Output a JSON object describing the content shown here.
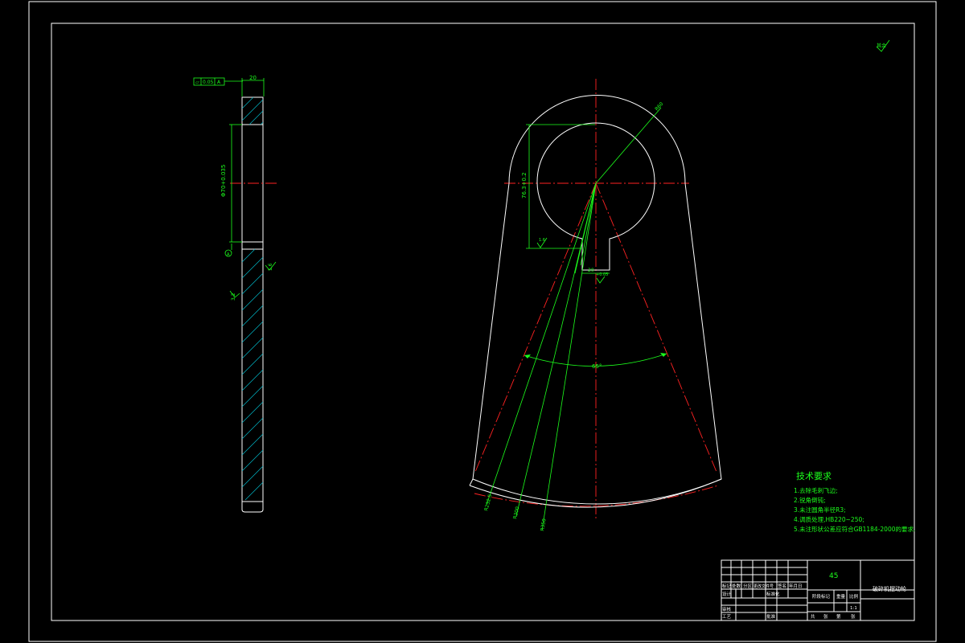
{
  "drawing": {
    "roughness_mark": "其余",
    "tolerance_frame": [
      "▱",
      "0.05",
      "A"
    ],
    "side_view": {
      "width_dim": "20",
      "bore_dim": "Φ70+0.035",
      "datum": "A",
      "roughness_right": "1.6",
      "roughness_left": "3.2"
    },
    "front_view": {
      "radius_top": "R60",
      "height_dim": "76.3+0.2",
      "roughness_bore": "1.6",
      "keyway_width": "20",
      "keyway_tol": "+0.05",
      "angle_dim": "65°",
      "radius_outer": "R232.5",
      "radius_mid": "R300",
      "radius_inner": "R350"
    },
    "technical_requirements": {
      "title": "技术要求",
      "items": [
        "1.去除毛刺飞边;",
        "2.锐角倒钝;",
        "3.未注圆角半径R3;",
        "4.调质处理,HB220~250;",
        "5.未注形状公差应符合GB1184-2000的要求."
      ]
    },
    "title_block": {
      "material": "45",
      "part_name": "破碎机摆动轮",
      "labels": [
        "设计",
        "审核",
        "工艺",
        "标准化",
        "批准",
        "标记",
        "处数",
        "分区",
        "更改文件号",
        "签名",
        "年月日"
      ],
      "stage": "阶段标记",
      "weight": "重量",
      "scale": "比例",
      "scale_value": "1:1",
      "sheet": [
        "共",
        "张",
        "第",
        "张"
      ]
    }
  }
}
